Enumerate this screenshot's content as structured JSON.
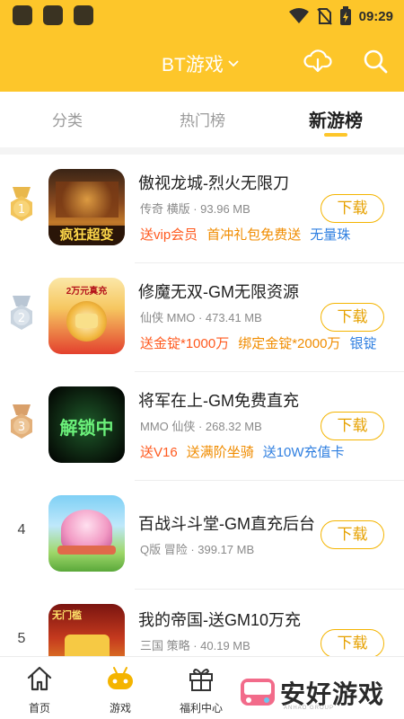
{
  "status_bar": {
    "time": "09:29"
  },
  "header": {
    "title": "BT游戏"
  },
  "tabs": [
    {
      "label": "分类",
      "active": false
    },
    {
      "label": "热门榜",
      "active": false
    },
    {
      "label": "新游榜",
      "active": true
    }
  ],
  "games": [
    {
      "rank": "1",
      "title": "傲视龙城-烈火无限刀",
      "meta": "传奇 横版 · 93.96 MB",
      "tags": [
        {
          "text": "送vip会员",
          "color": "#FF5A1F"
        },
        {
          "text": "首冲礼包免费送",
          "color": "#F08C00"
        },
        {
          "text": "无量珠",
          "color": "#2F7FE0"
        }
      ],
      "thumb_text": "疯狂超变",
      "button": "下载"
    },
    {
      "rank": "2",
      "title": "修魔无双-GM无限资源",
      "meta": "仙侠 MMO · 473.41 MB",
      "tags": [
        {
          "text": "送金锭*1000万",
          "color": "#FF5A1F"
        },
        {
          "text": "绑定金锭*2000万",
          "color": "#F08C00"
        },
        {
          "text": "银锭",
          "color": "#2F7FE0"
        }
      ],
      "thumb_text": "2万元真充",
      "button": "下载"
    },
    {
      "rank": "3",
      "title": "将军在上-GM免费直充",
      "meta": "MMO 仙侠 · 268.32 MB",
      "tags": [
        {
          "text": "送V16",
          "color": "#FF5A1F"
        },
        {
          "text": "送满阶坐骑",
          "color": "#F08C00"
        },
        {
          "text": "送10W充值卡",
          "color": "#2F7FE0"
        }
      ],
      "thumb_text": "解锁中",
      "button": "下载"
    },
    {
      "rank": "4",
      "title": "百战斗斗堂-GM直充后台",
      "meta": "Q版 冒险 · 399.17 MB",
      "tags": [],
      "thumb_text": "",
      "button": "下载"
    },
    {
      "rank": "5",
      "title": "我的帝国-送GM10万充",
      "meta": "三国 策略 · 40.19 MB",
      "tags": [],
      "thumb_text": "无门槛",
      "button": "下载"
    }
  ],
  "bottom_nav": [
    {
      "label": "首页",
      "icon": "home-icon"
    },
    {
      "label": "游戏",
      "icon": "gamepad-icon"
    },
    {
      "label": "福利中心",
      "icon": "gift-icon"
    }
  ],
  "watermark": {
    "text": "安好游戏",
    "sub": "ANHAO GROUP"
  },
  "colors": {
    "brand": "#FDC62A",
    "download": "#E6A100"
  }
}
